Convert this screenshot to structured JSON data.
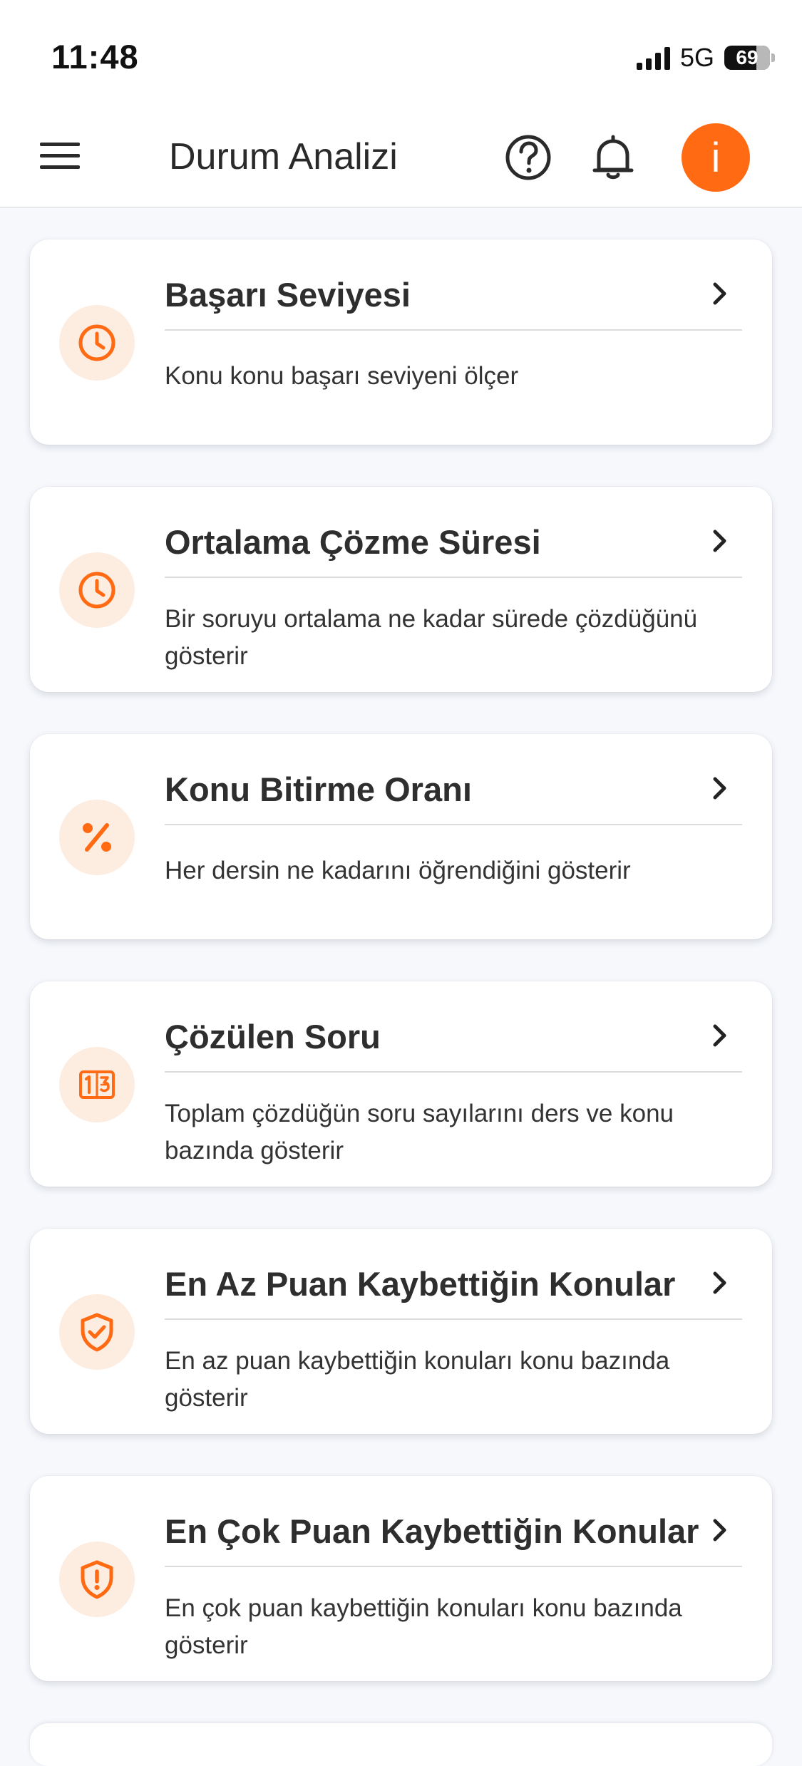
{
  "status_bar": {
    "time": "11:48",
    "network": "5G",
    "battery": "69"
  },
  "header": {
    "title": "Durum Analizi",
    "avatar_letter": "i",
    "accent_color": "#ff6a13"
  },
  "cards": [
    {
      "title": "Başarı Seviyesi",
      "description": "Konu konu başarı seviyeni ölçer",
      "icon": "clock-icon"
    },
    {
      "title": "Ortalama Çözme Süresi",
      "description": "Bir soruyu ortalama ne kadar sürede çözdüğünü gösterir",
      "icon": "clock-icon"
    },
    {
      "title": "Konu Bitirme Oranı",
      "description": "Her dersin ne kadarını öğrendiğini gösterir",
      "icon": "percent-icon"
    },
    {
      "title": "Çözülen Soru",
      "description": "Toplam çözdüğün soru sayılarını ders ve konu bazında gösterir",
      "icon": "numbers-icon"
    },
    {
      "title": "En Az Puan Kaybettiğin Konular",
      "description": "En az puan kaybettiğin konuları konu bazında gösterir",
      "icon": "shield-check-icon"
    },
    {
      "title": "En Çok Puan Kaybettiğin Konular",
      "description": "En çok puan kaybettiğin konuları konu bazında gösterir",
      "icon": "shield-alert-icon"
    }
  ]
}
